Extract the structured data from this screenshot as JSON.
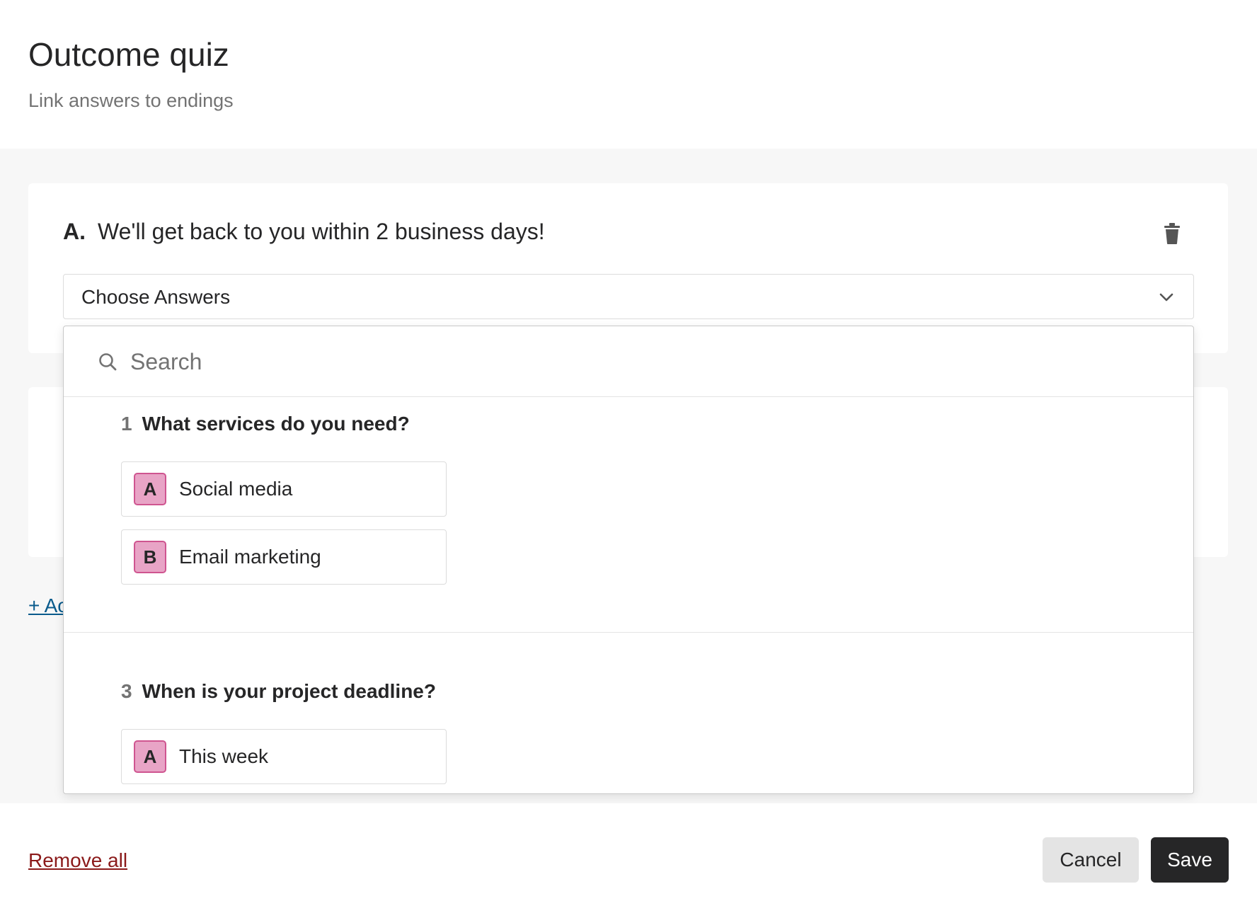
{
  "header": {
    "title": "Outcome quiz",
    "subtitle": "Link answers to endings"
  },
  "ending": {
    "label": "A.",
    "text": "We'll get back to you within 2 business days!",
    "trash_icon": "trash-icon"
  },
  "select": {
    "label": "Choose Answers",
    "chevron_icon": "chevron-down-icon"
  },
  "add_link": "+ Ac",
  "dropdown": {
    "search_placeholder": "Search",
    "questions": [
      {
        "number": "1",
        "title": "What services do you need?",
        "answers": [
          {
            "key": "A",
            "label": "Social media"
          },
          {
            "key": "B",
            "label": "Email marketing"
          }
        ]
      },
      {
        "number": "3",
        "title": "When is your project deadline?",
        "answers": [
          {
            "key": "A",
            "label": "This week"
          }
        ]
      }
    ]
  },
  "footer": {
    "remove_all": "Remove all",
    "cancel": "Cancel",
    "save": "Save"
  },
  "colors": {
    "answer_key_bg": "#e8a4c6",
    "answer_key_border": "#cf5590",
    "link_blue": "#0a5b8c",
    "remove_red": "#8b1a1a",
    "save_bg": "#262627",
    "cancel_bg": "#e4e4e4"
  }
}
